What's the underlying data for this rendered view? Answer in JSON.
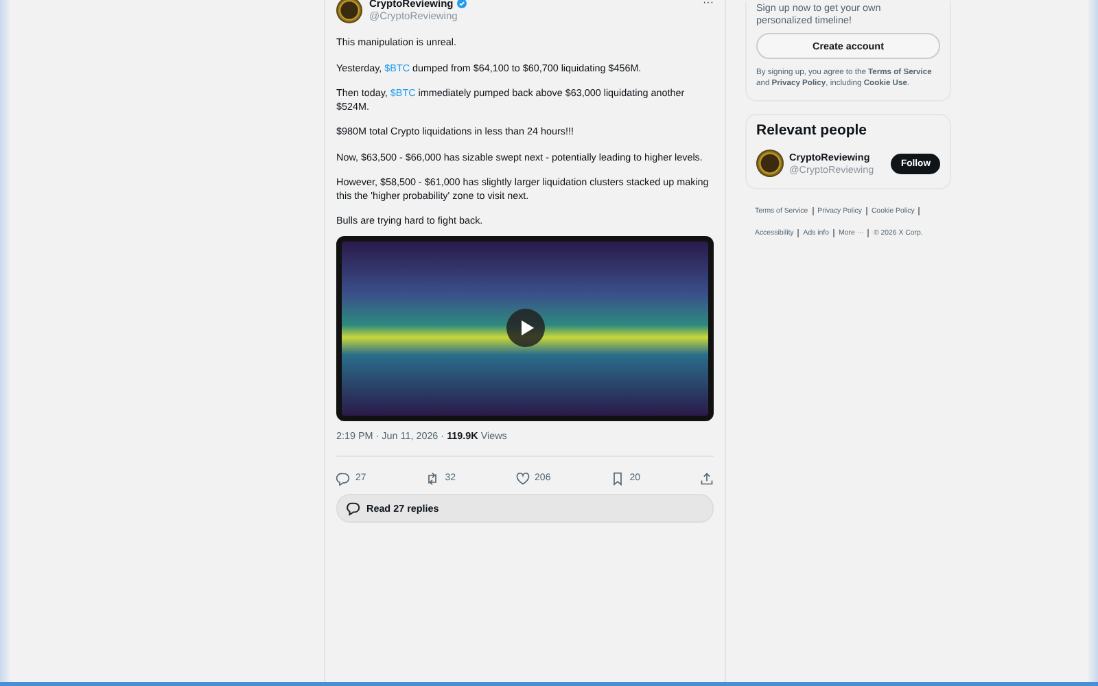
{
  "tweet": {
    "author": "CryptoReviewing",
    "verified": true,
    "handle": "@CryptoReviewing",
    "more": "···",
    "paragraphs": [
      [
        {
          "text": "This manipulation is unreal.",
          "kind": "text"
        }
      ],
      [
        {
          "text": "Yesterday, ",
          "kind": "text"
        },
        {
          "text": "$BTC",
          "kind": "cashtag"
        },
        {
          "text": " dumped from $64,100 to $60,700 liquidating $456M.",
          "kind": "text"
        }
      ],
      [
        {
          "text": "Then today, ",
          "kind": "text"
        },
        {
          "text": "$BTC",
          "kind": "cashtag"
        },
        {
          "text": " immediately pumped back above $63,000 liquidating another $524M.",
          "kind": "text"
        }
      ],
      [
        {
          "text": "$980M total Crypto liquidations in less than 24 hours!!!",
          "kind": "text"
        }
      ],
      [
        {
          "text": "Now, $63,500 - $66,000 has sizable  swept next - potentially leading to higher levels.",
          "kind": "text"
        }
      ],
      [
        {
          "text": "However, $58,500 - $61,000 has slightly larger liquidation clusters stacked up making this the 'higher probability' zone to visit next.",
          "kind": "text"
        }
      ],
      [
        {
          "text": "Bulls are trying hard to fight back.",
          "kind": "text"
        }
      ]
    ],
    "timestamp": "2:19 PM · Jun 11, 2026 · ",
    "views": "119.9K",
    "views_label": "Views",
    "actions": [
      {
        "kind": "reply",
        "count": "27"
      },
      {
        "kind": "repost",
        "count": "32"
      },
      {
        "kind": "like",
        "count": "206"
      },
      {
        "kind": "bookmark",
        "count": "20"
      },
      {
        "kind": "share"
      }
    ],
    "read_replies": "Read 27 replies"
  },
  "sidebar": {
    "signup_text": "Sign up now to get your own personalized timeline!",
    "create_account": "Create account",
    "terms": "By signing up, you agree to the **Terms of Service** and **Privacy Policy**, including **Cookie Use**.",
    "relevant_title": "Relevant people",
    "person": {
      "name": "CryptoReviewing",
      "handle": "@CryptoReviewing",
      "button": "Follow"
    },
    "footer_lines": [
      [
        "Terms of Service",
        "Privacy Policy",
        "Cookie Policy"
      ],
      [
        "Accessibility",
        "Ads info",
        "More ···",
        "© 2026 X Corp."
      ]
    ]
  }
}
